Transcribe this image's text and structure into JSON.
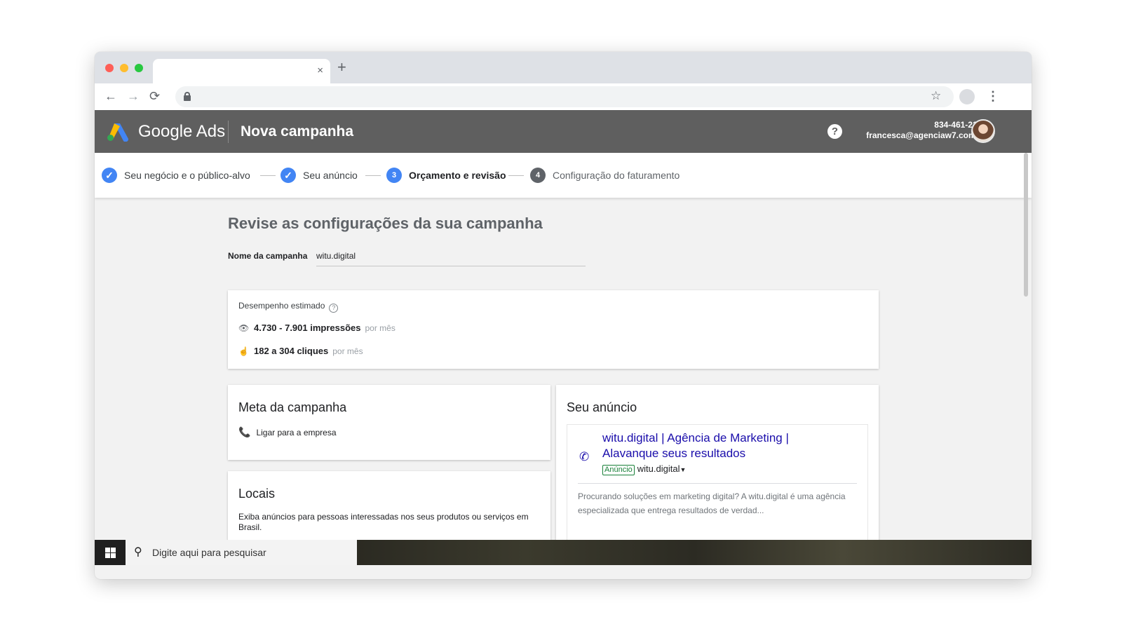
{
  "browser": {
    "tab_close": "×",
    "new_tab": "+",
    "back": "←",
    "forward": "→",
    "reload": "⟳",
    "star": "☆",
    "menu": "⋮"
  },
  "header": {
    "brand": "Google Ads",
    "title": "Nova campanha",
    "help": "?",
    "phone": "834-461-2145",
    "email": "francesca@agenciaw7.com.br"
  },
  "stepper": {
    "steps": [
      {
        "number": "✓",
        "label": "Seu negócio e o público-alvo",
        "state": "done"
      },
      {
        "number": "✓",
        "label": "Seu anúncio",
        "state": "done"
      },
      {
        "number": "3",
        "label": "Orçamento e revisão",
        "state": "current"
      },
      {
        "number": "4",
        "label": "Configuração do faturamento",
        "state": "pending"
      }
    ]
  },
  "main": {
    "heading": "Revise as configurações da sua campanha",
    "campaign_name_label": "Nome da campanha",
    "campaign_name_value": "witu.digital"
  },
  "performance": {
    "title": "Desempenho estimado",
    "info": "?",
    "impressions_value": "4.730 - 7.901 impressões",
    "impressions_period": "por mês",
    "clicks_value": "182 a 304 cliques",
    "clicks_period": "por mês"
  },
  "goal": {
    "title": "Meta da campanha",
    "item": "Ligar para a empresa"
  },
  "locations": {
    "title": "Locais",
    "description": "Exiba anúncios para pessoas interessadas nos seus produtos ou serviços em Brasil."
  },
  "ad": {
    "title": "Seu anúncio",
    "headline": "witu.digital | Agência de Marketing | Alavanque seus resultados",
    "badge": "Anúncio",
    "display_url": "witu.digital",
    "description": "Procurando soluções em marketing digital? A witu.digital é uma agência especializada que entrega resultados de verdad..."
  },
  "taskbar": {
    "search_placeholder": "Digite aqui para pesquisar"
  },
  "colors": {
    "header_bg": "#5f5f5f",
    "accent": "#4285f4",
    "ad_link": "#1a0dab",
    "ad_badge": "#188038"
  }
}
